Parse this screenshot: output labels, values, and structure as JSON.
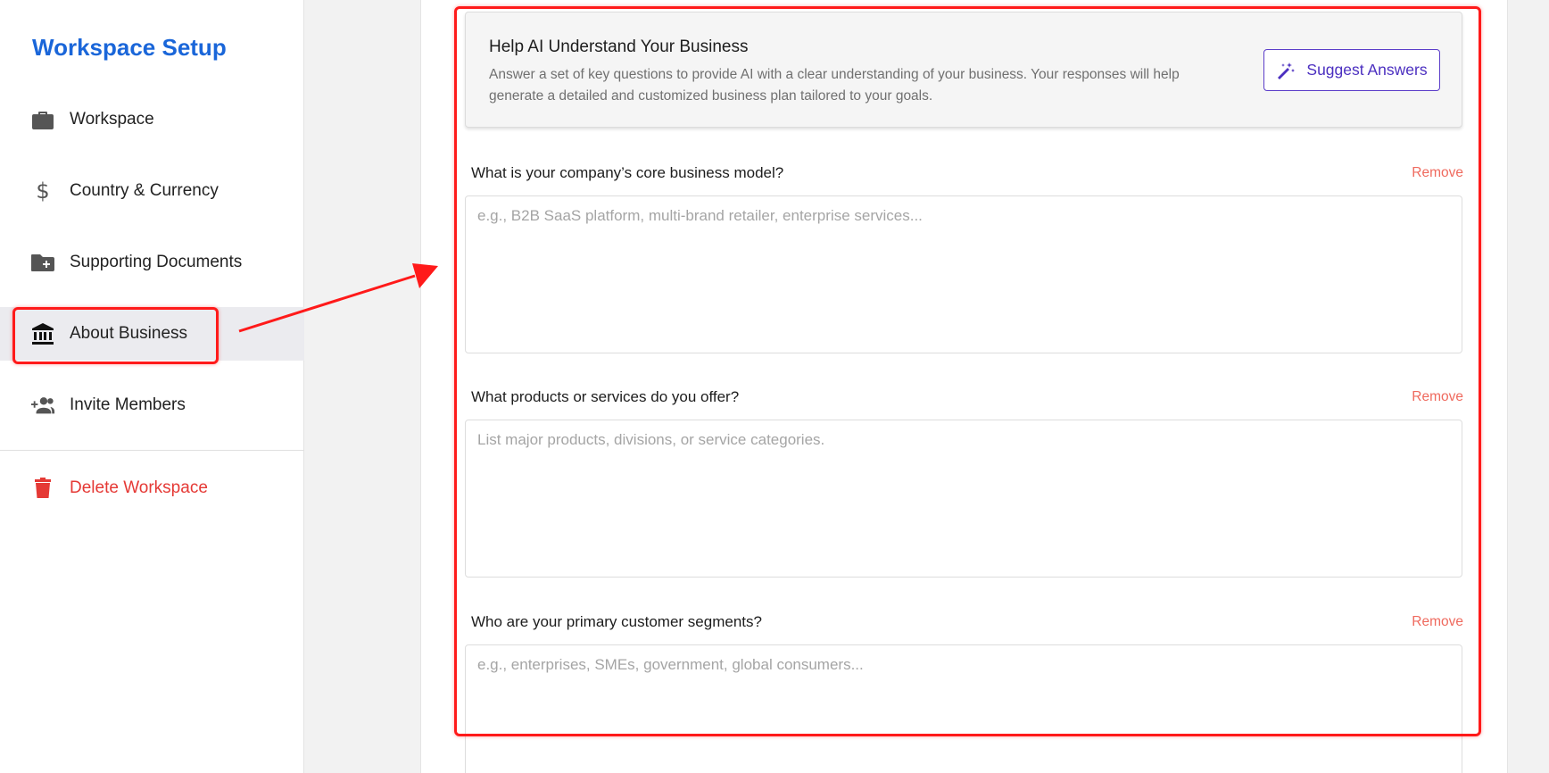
{
  "sidebar": {
    "title": "Workspace Setup",
    "items": [
      {
        "label": "Workspace",
        "icon": "briefcase-icon"
      },
      {
        "label": "Country & Currency",
        "icon": "dollar-icon"
      },
      {
        "label": "Supporting Documents",
        "icon": "folder-plus-icon"
      },
      {
        "label": "About Business",
        "icon": "bank-icon",
        "active": true
      },
      {
        "label": "Invite Members",
        "icon": "person-add-icon"
      }
    ],
    "delete_label": "Delete Workspace"
  },
  "info_card": {
    "title": "Help AI Understand Your Business",
    "description": "Answer a set of key questions to provide AI with a clear understanding of your business. Your responses will help generate a detailed and customized business plan tailored to your goals.",
    "suggest_button": "Suggest Answers"
  },
  "questions": [
    {
      "label": "What is your company’s core business model?",
      "placeholder": "e.g., B2B SaaS platform, multi-brand retailer, enterprise services...",
      "value": "",
      "remove_label": "Remove"
    },
    {
      "label": "What products or services do you offer?",
      "placeholder": "List major products, divisions, or service categories.",
      "value": "",
      "remove_label": "Remove"
    },
    {
      "label": "Who are your primary customer segments?",
      "placeholder": "e.g., enterprises, SMEs, government, global consumers...",
      "value": "",
      "remove_label": "Remove"
    }
  ],
  "colors": {
    "accent": "#1a66d9",
    "suggest": "#4b2fc0",
    "danger": "#e53935",
    "remove": "#ef6a5e",
    "annotation": "#ff1a1a"
  }
}
